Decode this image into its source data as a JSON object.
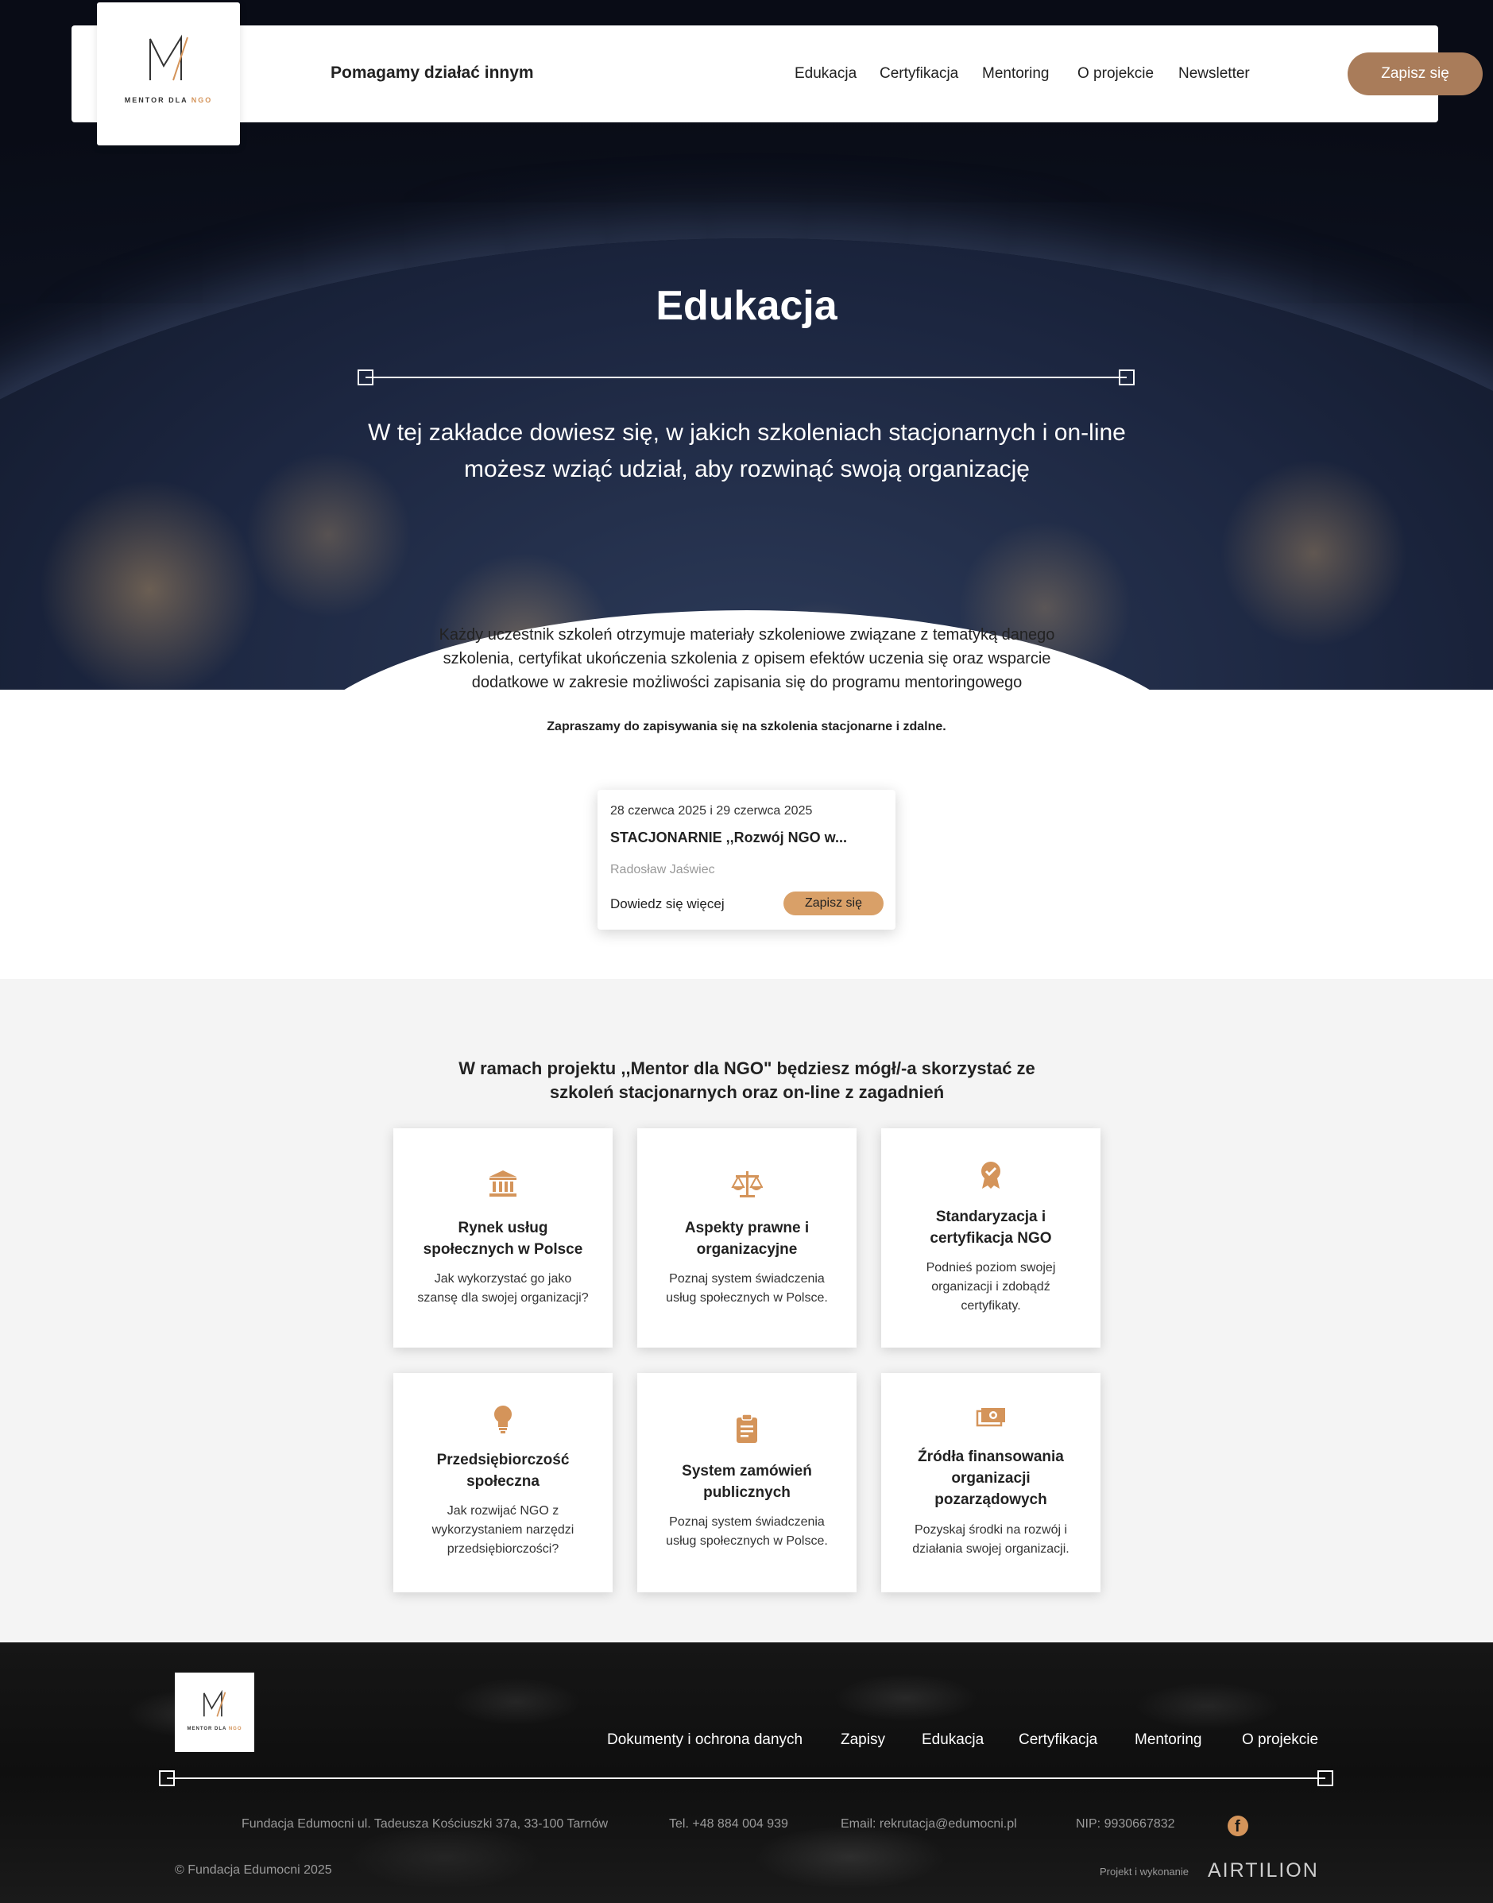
{
  "header": {
    "logo_text": "MENTOR DLA",
    "logo_accent": "NGO",
    "tagline": "Pomagamy działać innym",
    "nav": [
      "Edukacja",
      "Certyfikacja",
      "Mentoring",
      "O projekcie",
      "Newsletter"
    ],
    "cta": "Zapisz się"
  },
  "hero": {
    "title": "Edukacja",
    "subtitle": "W tej zakładce dowiesz się, w jakich szkoleniach stacjonarnych i on-line możesz wziąć udział, aby rozwinąć swoją organizację",
    "info": "Każdy uczestnik szkoleń otrzymuje materiały szkoleniowe związane z tematyką danego szkolenia, certyfikat ukończenia szkolenia z opisem efektów uczenia się oraz wsparcie dodatkowe w zakresie możliwości zapisania się do programu mentoringowego",
    "invite": "Zapraszamy do zapisywania się na szkolenia stacjonarne i zdalne."
  },
  "course": {
    "date": "28 czerwca 2025 i 29 czerwca 2025",
    "title": "STACJONARNIE ,,Rozwój NGO w...",
    "author": "Radosław Jaświec",
    "more": "Dowiedz się więcej",
    "signup": "Zapisz się"
  },
  "topics": {
    "title": "W ramach projektu ,,Mentor dla NGO\" będziesz mógł/-a skorzystać ze szkoleń stacjonarnych oraz on-line z zagadnień",
    "items": [
      {
        "icon": "bank-icon",
        "title": "Rynek usług społecznych w Polsce",
        "desc": "Jak wykorzystać go jako szansę dla swojej organizacji?"
      },
      {
        "icon": "scales-icon",
        "title": "Aspekty prawne i organizacyjne",
        "desc": "Poznaj system świadczenia usług społecznych w Polsce."
      },
      {
        "icon": "award-icon",
        "title": "Standaryzacja i certyfikacja NGO",
        "desc": "Podnieś poziom swojej organizacji i zdobądź certyfikaty."
      },
      {
        "icon": "lightbulb-icon",
        "title": "Przedsiębiorczość społeczna",
        "desc": "Jak rozwijać NGO z wykorzystaniem narzędzi przedsiębiorczości?"
      },
      {
        "icon": "clipboard-icon",
        "title": "System zamówień publicznych",
        "desc": "Poznaj system świadczenia usług społecznych w Polsce."
      },
      {
        "icon": "money-icon",
        "title": "Źródła finansowania organizacji pozarządowych",
        "desc": "Pozyskaj środki na rozwój i działania swojej organizacji."
      }
    ]
  },
  "footer": {
    "logo_text": "MENTOR DLA",
    "logo_accent": "NGO",
    "nav": [
      "Dokumenty i ochrona danych",
      "Zapisy",
      "Edukacja",
      "Certyfikacja",
      "Mentoring",
      "O projekcie"
    ],
    "address": "Fundacja Edumocni ul. Tadeusza Kościuszki 37a, 33-100 Tarnów",
    "phone": "Tel. +48 884 004 939",
    "email": "Email: rekrutacja@edumocni.pl",
    "nip": "NIP: 9930667832",
    "copyright": "© Fundacja Edumocni 2025",
    "credit": "Projekt i wykonanie",
    "credit_brand": "AIRTILION"
  },
  "colors": {
    "accent": "#d4945a",
    "header_button": "#a97c5a",
    "card_button": "#d9a068",
    "dark": "#0e1322"
  }
}
